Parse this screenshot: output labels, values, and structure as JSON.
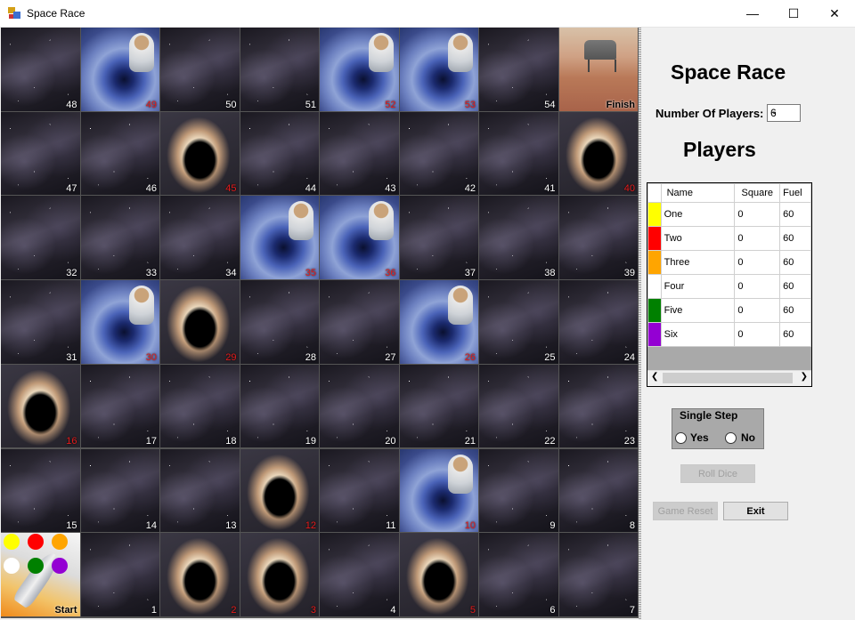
{
  "window": {
    "title": "Space Race",
    "min_glyph": "—",
    "max_glyph": "☐",
    "close_glyph": "✕"
  },
  "board": {
    "rows": [
      [
        {
          "n": "48",
          "t": "space"
        },
        {
          "n": "49",
          "t": "wormhole"
        },
        {
          "n": "50",
          "t": "space"
        },
        {
          "n": "51",
          "t": "space"
        },
        {
          "n": "52",
          "t": "wormhole"
        },
        {
          "n": "53",
          "t": "wormhole"
        },
        {
          "n": "54",
          "t": "space"
        },
        {
          "n": "Finish",
          "t": "finish"
        }
      ],
      [
        {
          "n": "47",
          "t": "space"
        },
        {
          "n": "46",
          "t": "space"
        },
        {
          "n": "45",
          "t": "blackhole"
        },
        {
          "n": "44",
          "t": "space"
        },
        {
          "n": "43",
          "t": "space"
        },
        {
          "n": "42",
          "t": "space"
        },
        {
          "n": "41",
          "t": "space"
        },
        {
          "n": "40",
          "t": "blackhole"
        }
      ],
      [
        {
          "n": "32",
          "t": "space"
        },
        {
          "n": "33",
          "t": "space"
        },
        {
          "n": "34",
          "t": "space"
        },
        {
          "n": "35",
          "t": "wormhole"
        },
        {
          "n": "36",
          "t": "wormhole"
        },
        {
          "n": "37",
          "t": "space"
        },
        {
          "n": "38",
          "t": "space"
        },
        {
          "n": "39",
          "t": "space"
        }
      ],
      [
        {
          "n": "31",
          "t": "space"
        },
        {
          "n": "30",
          "t": "wormhole"
        },
        {
          "n": "29",
          "t": "blackhole"
        },
        {
          "n": "28",
          "t": "space"
        },
        {
          "n": "27",
          "t": "space"
        },
        {
          "n": "26",
          "t": "wormhole"
        },
        {
          "n": "25",
          "t": "space"
        },
        {
          "n": "24",
          "t": "space"
        }
      ],
      [
        {
          "n": "16",
          "t": "blackhole"
        },
        {
          "n": "17",
          "t": "space"
        },
        {
          "n": "18",
          "t": "space"
        },
        {
          "n": "19",
          "t": "space"
        },
        {
          "n": "20",
          "t": "space"
        },
        {
          "n": "21",
          "t": "space"
        },
        {
          "n": "22",
          "t": "space"
        },
        {
          "n": "23",
          "t": "space"
        }
      ],
      [
        {
          "n": "15",
          "t": "space"
        },
        {
          "n": "14",
          "t": "space"
        },
        {
          "n": "13",
          "t": "space"
        },
        {
          "n": "12",
          "t": "blackhole"
        },
        {
          "n": "11",
          "t": "space"
        },
        {
          "n": "10",
          "t": "wormhole"
        },
        {
          "n": "9",
          "t": "space"
        },
        {
          "n": "8",
          "t": "space"
        }
      ],
      [
        {
          "n": "Start",
          "t": "start"
        },
        {
          "n": "1",
          "t": "space"
        },
        {
          "n": "2",
          "t": "blackhole"
        },
        {
          "n": "3",
          "t": "blackhole"
        },
        {
          "n": "4",
          "t": "space"
        },
        {
          "n": "5",
          "t": "blackhole"
        },
        {
          "n": "6",
          "t": "space"
        },
        {
          "n": "7",
          "t": "space"
        }
      ]
    ],
    "tokens": [
      "#ffff00",
      "#ff0000",
      "#ffa500",
      "#ffffff",
      "#008000",
      "#9400d3"
    ]
  },
  "panel": {
    "title": "Space Race",
    "players_label": "Number Of Players:",
    "players_value": "6",
    "players_heading": "Players",
    "grid": {
      "headers": [
        "",
        "Name",
        "Square",
        "Fuel"
      ],
      "rows": [
        {
          "color": "#ffff00",
          "name": "One",
          "square": "0",
          "fuel": "60"
        },
        {
          "color": "#ff0000",
          "name": "Two",
          "square": "0",
          "fuel": "60"
        },
        {
          "color": "#ffa500",
          "name": "Three",
          "square": "0",
          "fuel": "60"
        },
        {
          "color": "#ffffff",
          "name": "Four",
          "square": "0",
          "fuel": "60"
        },
        {
          "color": "#008000",
          "name": "Five",
          "square": "0",
          "fuel": "60"
        },
        {
          "color": "#9400d3",
          "name": "Six",
          "square": "0",
          "fuel": "60"
        }
      ]
    },
    "single_step": {
      "title": "Single Step",
      "yes": "Yes",
      "no": "No"
    },
    "roll_dice": "Roll Dice",
    "game_reset": "Game Reset",
    "exit": "Exit"
  }
}
